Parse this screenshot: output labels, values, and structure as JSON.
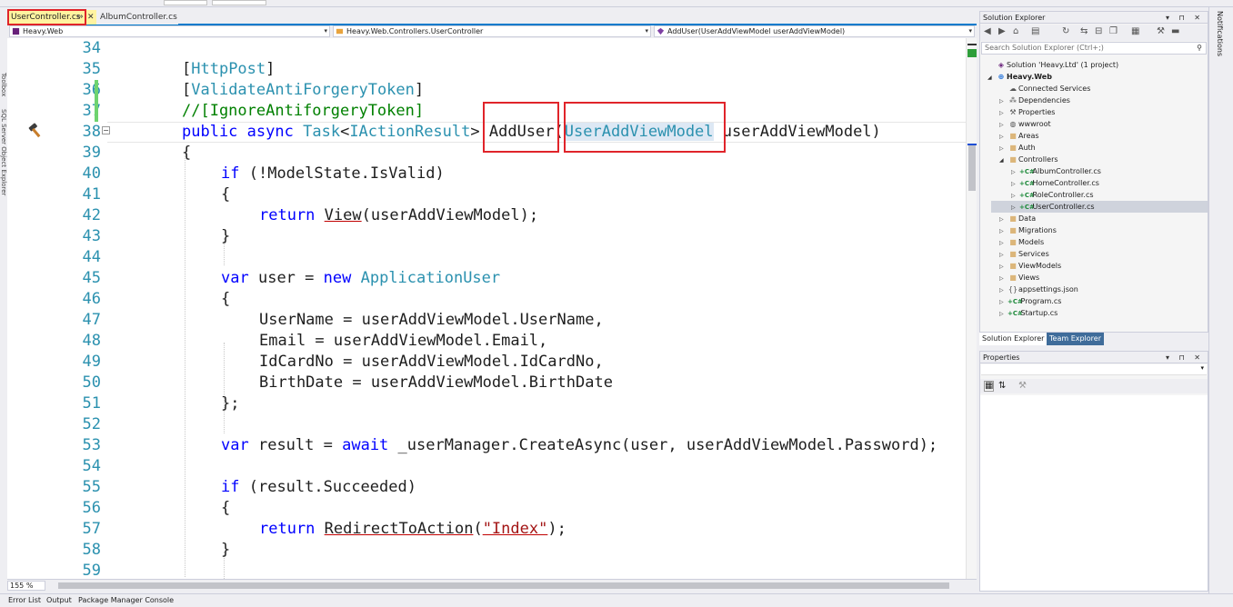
{
  "document_tabs": [
    {
      "label": "UserController.cs",
      "active": true
    },
    {
      "label": "AlbumController.cs",
      "active": false
    }
  ],
  "tab_glyphs": {
    "pin": "⇔",
    "close": "✕"
  },
  "navbar": {
    "project": "Heavy.Web",
    "class": "Heavy.Web.Controllers.UserController",
    "member": "AddUser(UserAddViewModel userAddViewModel)"
  },
  "editor": {
    "zoom": "155 %",
    "line_numbers": [
      "34",
      "35",
      "36",
      "37",
      "38",
      "39",
      "40",
      "41",
      "42",
      "43",
      "44",
      "45",
      "46",
      "47",
      "48",
      "49",
      "50",
      "51",
      "52",
      "53",
      "54",
      "55",
      "56",
      "57",
      "58",
      "59"
    ],
    "tokens": {
      "http_post": "HttpPost",
      "validate": "ValidateAntiForgeryToken",
      "ignore_comment": "//[IgnoreAntiforgeryToken]",
      "public": "public",
      "async": "async",
      "task": "Task",
      "iactionresult": "IActionResult",
      "adduser": "AddUser",
      "param_type": "UserAddViewModel",
      "param_name": "userAddViewModel",
      "if": "if",
      "model_state": "ModelState",
      "is_valid": "IsValid",
      "return": "return",
      "view": "View",
      "var": "var",
      "user": "user",
      "new": "new",
      "application_user": "ApplicationUser",
      "username_line": "UserName = userAddViewModel.UserName,",
      "email_line": "Email = userAddViewModel.Email,",
      "idcard_line": "IdCardNo = userAddViewModel.IdCardNo,",
      "birthdate_line": "BirthDate = userAddViewModel.BirthDate",
      "close_brace_semi": "};",
      "result": "result",
      "await": "await",
      "create_async": "_userManager.CreateAsync(user, userAddViewModel.Password);",
      "result_succeeded": "(result.Succeeded)",
      "redirect": "RedirectToAction",
      "index_str": "\"Index\""
    }
  },
  "solution_explorer": {
    "title": "Solution Explorer",
    "search_placeholder": "Search Solution Explorer (Ctrl+;)",
    "items": [
      {
        "label": "Solution 'Heavy.Ltd' (1 project)",
        "icon": "solution-icon",
        "bold": false
      },
      {
        "label": "Heavy.Web",
        "icon": "web-project-icon",
        "bold": true
      },
      {
        "label": "Connected Services",
        "icon": "connected-services-icon"
      },
      {
        "label": "Dependencies",
        "icon": "dependencies-icon"
      },
      {
        "label": "Properties",
        "icon": "wrench-icon"
      },
      {
        "label": "wwwroot",
        "icon": "globe-icon"
      },
      {
        "label": "Areas",
        "icon": "folder-icon"
      },
      {
        "label": "Auth",
        "icon": "folder-icon"
      },
      {
        "label": "Controllers",
        "icon": "folder-open-icon"
      },
      {
        "label": "AlbumController.cs",
        "icon": "csharp-file-icon"
      },
      {
        "label": "HomeController.cs",
        "icon": "csharp-file-icon"
      },
      {
        "label": "RoleController.cs",
        "icon": "csharp-file-icon"
      },
      {
        "label": "UserController.cs",
        "icon": "csharp-file-icon",
        "selected": true
      },
      {
        "label": "Data",
        "icon": "folder-icon"
      },
      {
        "label": "Migrations",
        "icon": "folder-icon"
      },
      {
        "label": "Models",
        "icon": "folder-icon"
      },
      {
        "label": "Services",
        "icon": "folder-icon"
      },
      {
        "label": "ViewModels",
        "icon": "folder-icon"
      },
      {
        "label": "Views",
        "icon": "folder-icon"
      },
      {
        "label": "appsettings.json",
        "icon": "json-file-icon"
      },
      {
        "label": "Program.cs",
        "icon": "csharp-file-icon"
      },
      {
        "label": "Startup.cs",
        "icon": "csharp-file-icon"
      }
    ],
    "bottom_tabs": [
      "Solution Explorer",
      "Team Explorer"
    ]
  },
  "properties_panel": {
    "title": "Properties"
  },
  "bottom_tabs": [
    "Error List",
    "Output",
    "Package Manager Console"
  ],
  "notifications_label": "Notifications",
  "left_dock": [
    "Toolbox",
    "SQL Server Object Explorer"
  ],
  "colors": {
    "keyword": "#0000ff",
    "type": "#2b91af",
    "comment": "#008000",
    "string": "#a31515",
    "line_number": "#2b91af",
    "annotation_box": "#e0242a",
    "active_tab": "#fff3a0",
    "accent": "#007acc"
  }
}
